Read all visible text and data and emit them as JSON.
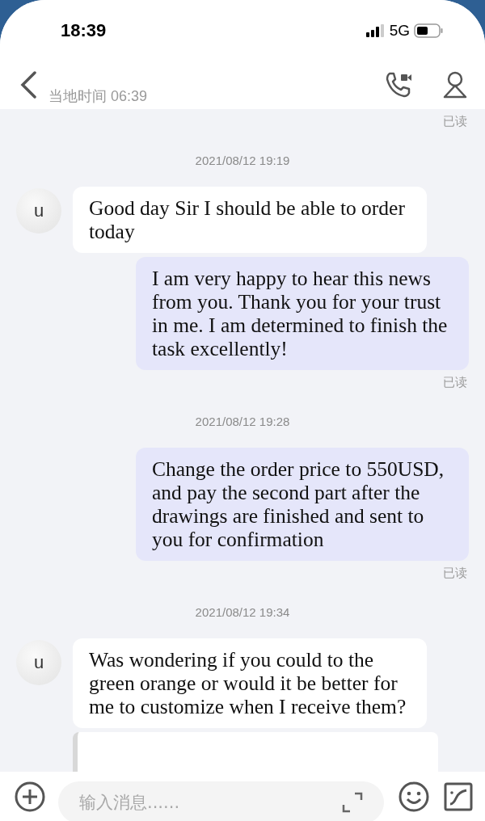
{
  "status_bar": {
    "time": "18:39",
    "network": "5G"
  },
  "header": {
    "subtitle": "当地时间 06:39"
  },
  "messages": [
    {
      "kind": "receipt",
      "text": "已读"
    },
    {
      "kind": "timestamp",
      "text": "2021/08/12 19:19"
    },
    {
      "kind": "incoming",
      "avatar": "u",
      "text": "Good day Sir I should be able to order today"
    },
    {
      "kind": "outgoing",
      "text": "I am very happy to hear this news from you. Thank you for your trust in me. I am determined to finish the task excellently!"
    },
    {
      "kind": "receipt",
      "text": "已读"
    },
    {
      "kind": "timestamp",
      "text": "2021/08/12 19:28"
    },
    {
      "kind": "outgoing",
      "text": "Change the order price to 550USD, and pay the second part after the drawings are finished and sent to you for confirmation"
    },
    {
      "kind": "receipt",
      "text": "已读"
    },
    {
      "kind": "timestamp",
      "text": "2021/08/12 19:34"
    },
    {
      "kind": "incoming",
      "avatar": "u",
      "text": "Was wondering if you could to the green orange or would it be better for me to customize when I receive them?"
    },
    {
      "kind": "translation"
    }
  ],
  "composer": {
    "placeholder": "输入消息......"
  }
}
